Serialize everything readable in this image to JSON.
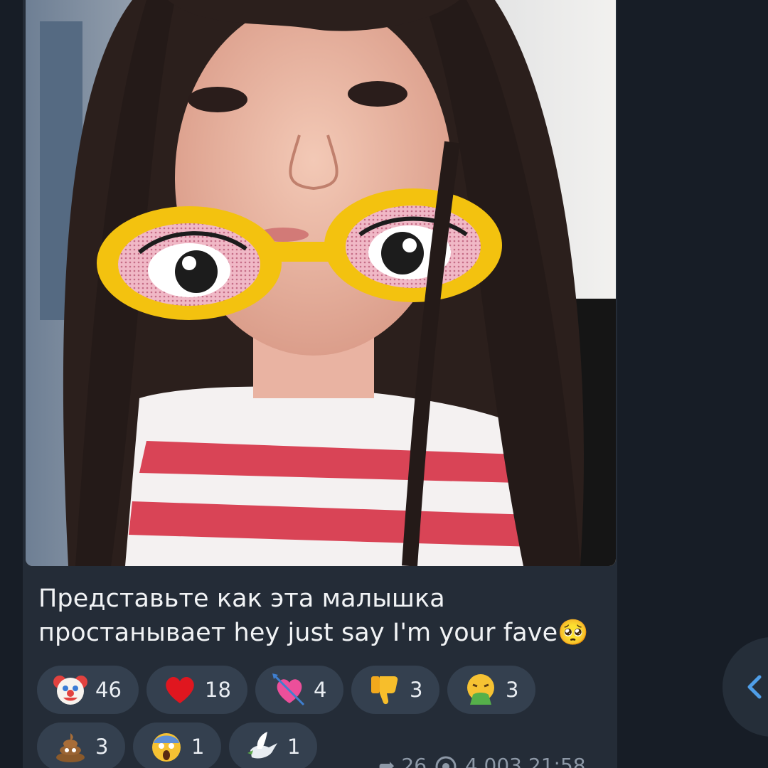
{
  "message": {
    "caption_lines": [
      "Представьте как эта малышка",
      "простанывает hey just say I'm your fave🥺"
    ],
    "reactions": [
      {
        "icon": "clown-face-icon",
        "count": "46"
      },
      {
        "icon": "red-heart-icon",
        "count": "18"
      },
      {
        "icon": "heart-with-arrow-icon",
        "count": "4"
      },
      {
        "icon": "thumbs-down-icon",
        "count": "3"
      },
      {
        "icon": "vomiting-face-icon",
        "count": "3"
      },
      {
        "icon": "pile-of-poo-icon",
        "count": "3"
      },
      {
        "icon": "screaming-face-icon",
        "count": "1"
      },
      {
        "icon": "dove-icon",
        "count": "1"
      }
    ],
    "forwards": "26",
    "views": "4 003",
    "time": "21:58"
  },
  "colors": {
    "background": "#171d26",
    "bubble": "#242c37",
    "reaction_pill": "#34404f",
    "accent": "#4f9ee8"
  }
}
